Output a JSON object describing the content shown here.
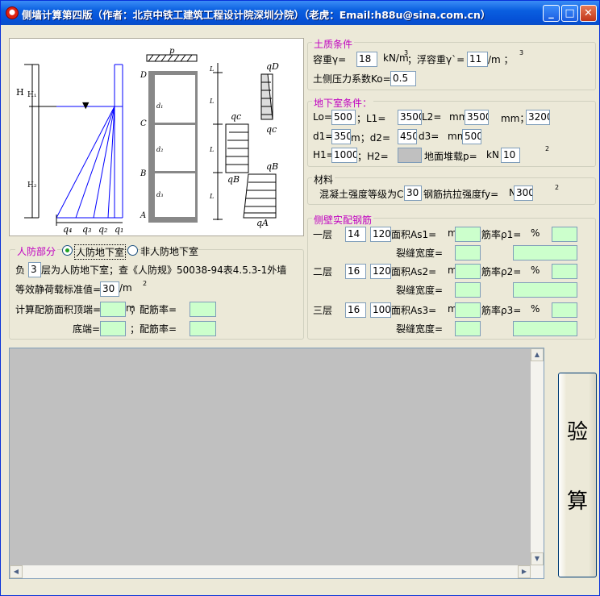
{
  "window": {
    "title": "侧墙计算第四版（作者：北京中铁工建筑工程设计院深圳分院）（老虎：Email:h88u@sina.com.cn）"
  },
  "diagram": {
    "p_label": "p",
    "h_label": "H",
    "h1_label": "H₁",
    "h2_label": "H₂",
    "left_q_labels": [
      "q₄",
      "q₃",
      "q₂",
      "q₁"
    ],
    "floor_labels": [
      "D",
      "C",
      "B",
      "A"
    ],
    "d_labels": [
      "d₁",
      "d₂",
      "d₃"
    ],
    "l_labels": [
      "L",
      "L",
      "L",
      "L"
    ],
    "load_labels": [
      "qD",
      "qc",
      "qc",
      "qB",
      "qB",
      "qA"
    ]
  },
  "soil": {
    "legend": "土质条件",
    "unit_weight_label": "容重γ=",
    "unit_weight": "18",
    "unit_weight_unit": "kN/m",
    "buoyant_label": "；浮容重γ`=",
    "buoyant": "11",
    "buoyant_unit": "/m ；",
    "sup3": "3",
    "k0_label": "土侧压力系数Ko=",
    "k0": "0.5"
  },
  "basement": {
    "legend": "地下室条件：",
    "lo_label": "Lo=",
    "lo": "500",
    "l1_label": "；L1=",
    "l1": "3500",
    "l2_label": "L2=",
    "mm1": "mm",
    "l2": "3500",
    "mm2": "mm；",
    "l3": "3200",
    "d1_label": "d1=",
    "d1": "350",
    "d2_label": "m；d2=",
    "d2": "450",
    "d3_label": "d3=",
    "mm3": "mm",
    "d3": "500",
    "h1_label": "H1=",
    "h1": "1000",
    "h2_label": "；H2=",
    "h2": "",
    "surcharge_label": "地面堆载p=",
    "surcharge_unit": "kN",
    "surcharge": "10",
    "sup2": "2"
  },
  "material": {
    "legend": "材料",
    "concrete_label": "混凝土强度等级为C",
    "concrete": "30",
    "steel_label": "钢筋抗拉强度fy=",
    "steel_unit": "N",
    "steel": "300",
    "sup2": "2"
  },
  "rebar": {
    "legend": "侧壁实配钢筋",
    "rows": [
      {
        "floor": "一层",
        "d": "14",
        "s": "120",
        "as_label": "面积As1=",
        "unit": "m",
        "rho_label": "筋率ρ1=",
        "pct": "%",
        "crack_label": "裂缝宽度="
      },
      {
        "floor": "二层",
        "d": "16",
        "s": "120",
        "as_label": "面积As2=",
        "unit": "m",
        "rho_label": "筋率ρ2=",
        "pct": "%",
        "crack_label": "裂缝宽度="
      },
      {
        "floor": "三层",
        "d": "16",
        "s": "100",
        "as_label": "面积As3=",
        "unit": "m",
        "rho_label": "筋率ρ3=",
        "pct": "%",
        "crack_label": "裂缝宽度="
      }
    ]
  },
  "civil": {
    "legend": "人防部分",
    "radio_on": "人防地下室",
    "radio_off": "非人防地下室",
    "neg_label": "负",
    "neg": "3",
    "neg_text": "层为人防地下室；查《人防规》50038-94表4.5.3-1外墙",
    "load_label": "等效静荷载标准值=",
    "load": "30",
    "load_unit": "/m",
    "sup2": "2",
    "top_label": "计算配筋面积顶端=",
    "top_unit": "m",
    "top_ratio_label": "；配筋率=",
    "bottom_label": "底端=",
    "bottom_ratio_label": "；配筋率="
  },
  "action": {
    "char1": "验",
    "char2": "算"
  }
}
